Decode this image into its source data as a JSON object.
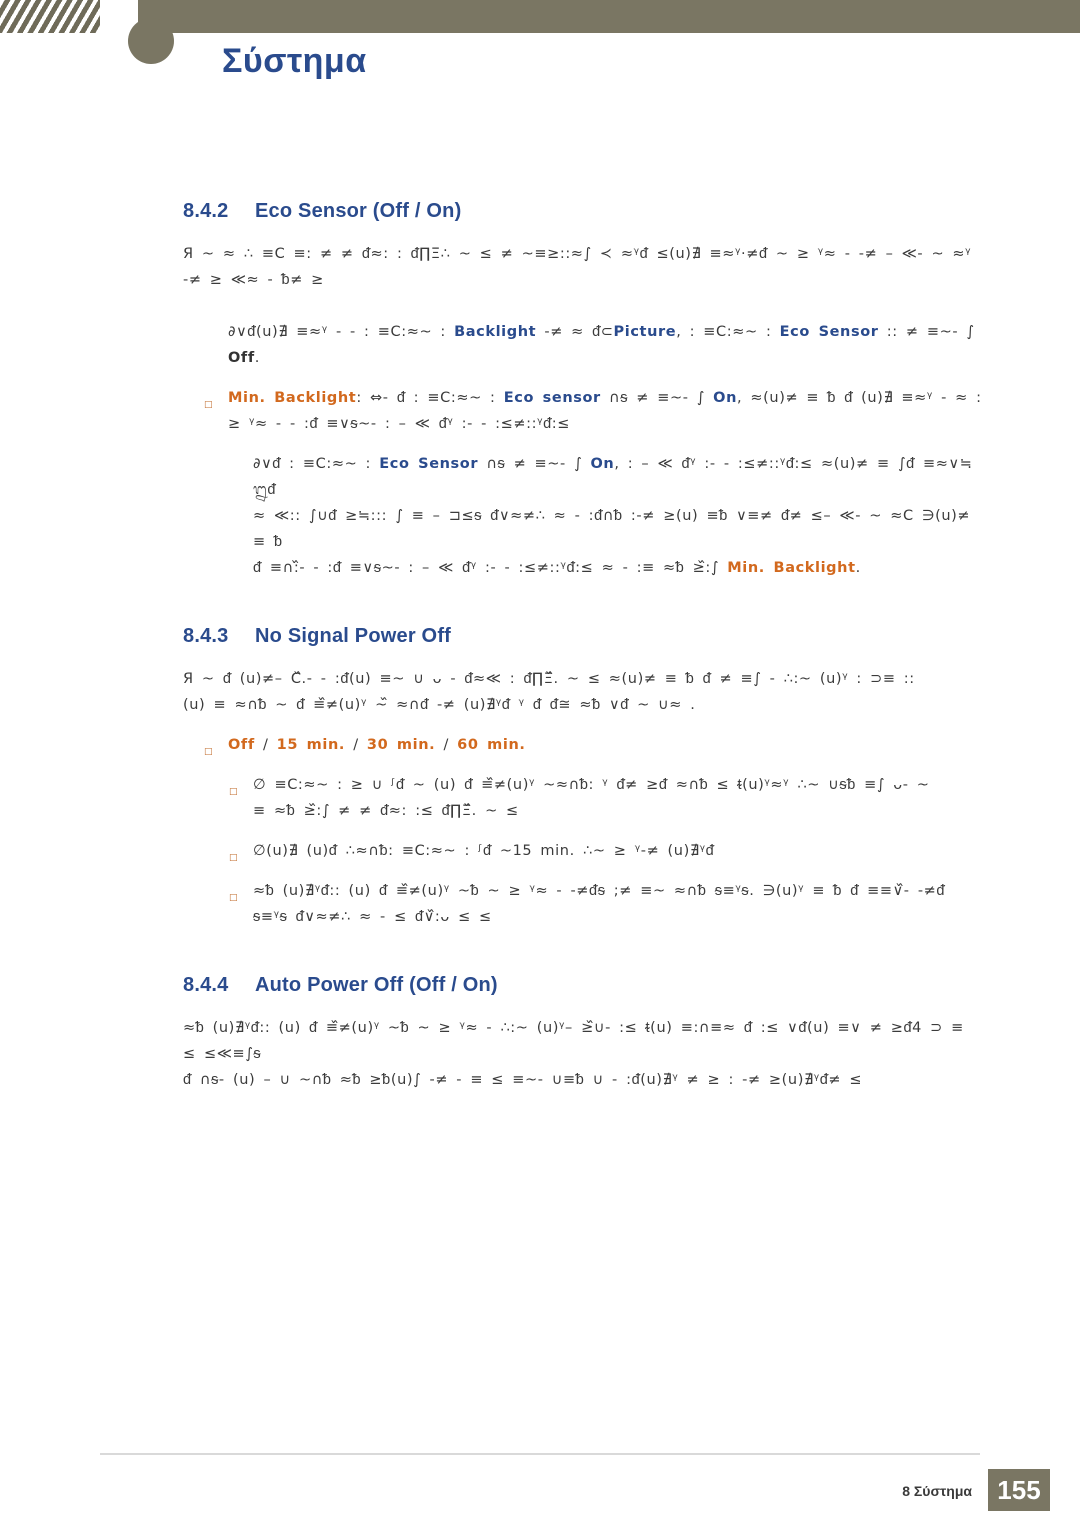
{
  "header": {
    "title": "Σύστημα"
  },
  "sections": [
    {
      "number": "8.4.2",
      "title": "Eco Sensor (Off / On)",
      "paragraphs": [
        {
          "indent": 0,
          "bullet": false,
          "runs": [
            {
              "t": "Я ~  ≈  ∴ ≡Ⅽ  ≡:   ≠ ≠ ᵭ≈:   :   ᵭ∏Ξ∴ ~ ≤ ≠ ~≡≥::≈∫    ≺  ≈ᵞᵭ ≤(u)∄    ≡≈ᵞ·≠ᵭ   ~  ≥ ᵞ≈ -    -≠ – ≪- ~ ≈ᵞ",
              "style": "plain"
            }
          ]
        },
        {
          "indent": 0,
          "bullet": false,
          "runs": [
            {
              "t": "-≠ ≥  ≪≈ - ᵬ≠ ≥",
              "style": "plain"
            }
          ]
        },
        {
          "indent": 1,
          "bullet": false,
          "runs": [
            {
              "t": "∂∨ᵭ(u)∄   ≡≈ᵞ  -  - : ≡Ⅽ:≈~ : ",
              "style": "plain"
            },
            {
              "t": "Backlight",
              "style": "kw-blue"
            },
            {
              "t": "  -≠ ≈ ᵭ⊂",
              "style": "plain"
            },
            {
              "t": "Picture",
              "style": "kw-blue"
            },
            {
              "t": ",  : ≡Ⅽ:≈~ : ",
              "style": "plain"
            },
            {
              "t": "Eco Sensor",
              "style": "kw-blue"
            },
            {
              "t": " ::  ≠ ≡~- ∫",
              "style": "plain"
            }
          ]
        },
        {
          "indent": 1,
          "bullet": false,
          "runs": [
            {
              "t": "Off",
              "style": "kw-dark"
            },
            {
              "t": ".",
              "style": "plain"
            }
          ]
        },
        {
          "indent": 1,
          "bullet": true,
          "runs": [
            {
              "t": "Min. Backlight",
              "style": "kw-orange"
            },
            {
              "t": ":  ⇔-  ᵭ : ≡Ⅽ:≈~ : ",
              "style": "plain"
            },
            {
              "t": "Eco sensor",
              "style": "kw-blue"
            },
            {
              "t": " ∩ᵴ ≠ ≡~- ∫    ",
              "style": "plain"
            },
            {
              "t": "On",
              "style": "kw-blue"
            },
            {
              "t": ", ≈(u)≠ ≡ ᵬ   ᵭ (u)∄    ≡≈ᵞ  -  ≈ :",
              "style": "plain"
            }
          ]
        },
        {
          "indent": 1,
          "bullet": false,
          "runs": [
            {
              "t": "≥ ᵞ≈ -   - :ᵭ ≡∨ᵴ~- : – ≪  ᵭᵞ :-   - :≤≠::ᵞᵭ:≤",
              "style": "plain"
            }
          ]
        },
        {
          "indent": 2,
          "bullet": false,
          "runs": [
            {
              "t": "∂∨ᵭ : ≡Ⅽ:≈~ : ",
              "style": "plain"
            },
            {
              "t": "Eco Sensor",
              "style": "kw-blue"
            },
            {
              "t": " ∩ᵴ ≠ ≡~- ∫    ",
              "style": "plain"
            },
            {
              "t": "On",
              "style": "kw-blue"
            },
            {
              "t": ", : – ≪   ᵭᵞ :-   - :≤≠::ᵞᵭ:≤ ≈(u)≠ ≡ ∫ᵭ   ≡≈∨≒ ᬍᵭ",
              "style": "plain"
            }
          ]
        },
        {
          "indent": 2,
          "bullet": false,
          "runs": [
            {
              "t": "≈ ≪:: ∫∪ᵭ   ≥≒::: ∫  ≡ – ⊐≤ᵴ   ᵭ∨≈≠∴  ≈ - :ᵭ∩ᵬ    :-≠ ≥(u) ≡ᵬ ∨≡≠ ᵭ≠ ≤– ≪- ~ ≈Ⅽ ∋(u)≠ ≡ ᵬ",
              "style": "plain"
            }
          ]
        },
        {
          "indent": 2,
          "bullet": false,
          "runs": [
            {
              "t": "ᵭ   ≡∩:᷈- - :ᵭ ≡∨ᵴ~- : – ≪  ᵭᵞ :-   - :≤≠::ᵞᵭ:≤ ≈ - :≡  ≈ᵬ ≥᷈:∫ ",
              "style": "plain"
            },
            {
              "t": "Min. Backlight",
              "style": "kw-orange"
            },
            {
              "t": ".",
              "style": "plain"
            }
          ]
        }
      ]
    },
    {
      "number": "8.4.3",
      "title": "No Signal Power Off",
      "paragraphs": [
        {
          "indent": 0,
          "bullet": false,
          "runs": [
            {
              "t": "Я ~  ᵭ    (u)≠– Ⅽ᷈.-   - :ᵭ(u) ≡~ ∪ ᴗ -   ᵭ≈≪   :  ᵭ∏Ξ᷈. ~ ≤ ≈(u)≠ ≡ ᵬ   ᵭ ≠ ≡∫   -  ∴:~ (u)ᵞ  : ⊃≡  ::",
              "style": "plain"
            }
          ]
        },
        {
          "indent": 0,
          "bullet": false,
          "runs": [
            {
              "t": "(u)  ≡  ≈∩ᵬ ~ ᵭ ≡᷈≠(u)ᵞ ~᷈ ≈∩ᵭ -≠ (u)∄ᵞᵭ ᵞ   ᵭ   ᵭ≅  ≈ᵬ ∨ᵭ ~ ∪≈ .",
              "style": "plain"
            }
          ]
        },
        {
          "indent": 1,
          "bullet": true,
          "runs": [
            {
              "t": "Off",
              "style": "kw-orange"
            },
            {
              "t": " / ",
              "style": "plain"
            },
            {
              "t": "15 min.",
              "style": "kw-orange"
            },
            {
              "t": " / ",
              "style": "plain"
            },
            {
              "t": "30 min.",
              "style": "kw-orange"
            },
            {
              "t": " / ",
              "style": "plain"
            },
            {
              "t": "60 min.",
              "style": "kw-orange"
            }
          ]
        },
        {
          "indent": 2,
          "bullet": true,
          "runs": [
            {
              "t": "∅ ≡Ⅽ:≈~ :   ≥ ∪ ᶴᵭ ~ (u) ᵭ ≡᷈≠(u)ᵞ ~≈∩ᵬ: ᵞ  ᵭ≠   ≥ᵭ    ≈∩ᵬ ≤ ᵵ(u)ᵞ≈ᵞ ∴~ ∪ᵴᵬ ≡∫  ᴗ-  ~",
              "style": "plain"
            }
          ]
        },
        {
          "indent": 2,
          "bullet": false,
          "runs": [
            {
              "t": "≡  ≈ᵬ ≥᷈:∫   ≠ ≠ ᵭ≈:   :≤  ᵭ∏Ξ᷈. ~ ≤",
              "style": "plain"
            }
          ]
        },
        {
          "indent": 2,
          "bullet": true,
          "runs": [
            {
              "t": "∅(u)∄ (u)ᵭ  ∴≈∩ᵬ: ≡Ⅽ:≈~ :   ᶴᵭ ~15 min. ∴~    ≥ ᵞ-≠ (u)∄ᵞᵭ",
              "style": "plain"
            }
          ]
        },
        {
          "indent": 2,
          "bullet": true,
          "runs": [
            {
              "t": "≈ᵬ (u)∄ᵞᵭ::    (u) ᵭ ≡᷈≠(u)ᵞ ~ᵬ  ~ ≥ ᵞ≈ -   -≠ᵭᵴ ;≠ ≡~ ≈∩ᵬ ᵴ≡ᵞᵴ. ∋(u)ᵞ ≡ ᵬ   ᵭ   ≡≡∨᷈- -≠ᵭ",
              "style": "plain"
            }
          ]
        },
        {
          "indent": 2,
          "bullet": false,
          "runs": [
            {
              "t": "ᵴ≡ᵞᵴ  ᵭ∨≈≠∴  ≈ - ≤  ᵭ∨᷈:ᴗ ≤     ≤",
              "style": "plain"
            }
          ]
        }
      ]
    },
    {
      "number": "8.4.4",
      "title": "Auto Power Off (Off / On)",
      "paragraphs": [
        {
          "indent": 0,
          "bullet": false,
          "runs": [
            {
              "t": "≈ᵬ (u)∄ᵞᵭ:: (u) ᵭ ≡᷈≠(u)ᵞ ~ᵬ   ~  ≥ ᵞ≈ -    ∴:~   (u)ᵞ– ≥᷈∪- :≤ ᵵ(u) ≡:∩≡≈  ᵭ  :≤  ∨ᵭ(u) ≡∨ ≠ ≥ᵭ4 ⊃ ≡  ≤ ≤≪≡∫ᵴ",
              "style": "plain"
            }
          ]
        },
        {
          "indent": 0,
          "bullet": false,
          "runs": [
            {
              "t": "ᵭ  ∩ᵴ-  (u) – ∪   ~∩ᵬ  ≈ᵬ ≥ᵬ(u)∫  -≠ - ≡  ≤  ≡~- ∪≡ᵬ ∪  - :ᵭ(u)∄ᵞ ≠ ≥ : -≠ ≥(u)∄ᵞᵭ≠ ≤",
              "style": "plain"
            }
          ]
        }
      ]
    }
  ],
  "footer": {
    "label": "8 Σύστημα",
    "page": "155"
  }
}
